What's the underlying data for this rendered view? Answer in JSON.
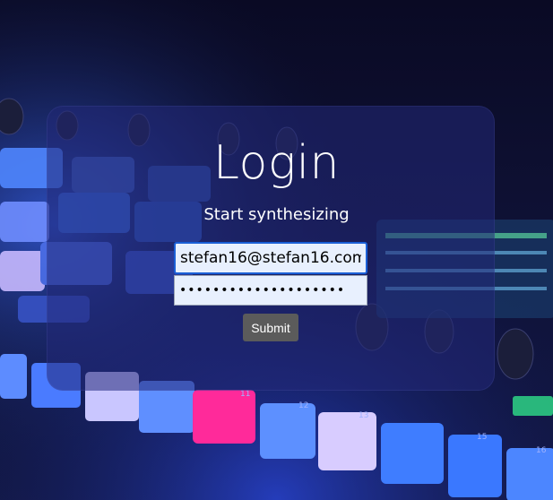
{
  "login": {
    "title": "Login",
    "subtitle": "Start synthesizing",
    "email_value": "stefan16@stefan16.com",
    "password_value": "password123456789012",
    "submit_label": "Submit"
  },
  "colors": {
    "card_overlay": "#222878",
    "input_bg": "#e8f0fe",
    "input_focus_border": "#1a5fd6",
    "button_bg": "#5b5b5b",
    "pad_pink": "#ff2a9a",
    "pad_blue": "#3a8cff"
  },
  "background": {
    "description_icon": "drum-machine-photo",
    "pad_numbers": [
      "11",
      "12",
      "13",
      "15",
      "16"
    ]
  }
}
